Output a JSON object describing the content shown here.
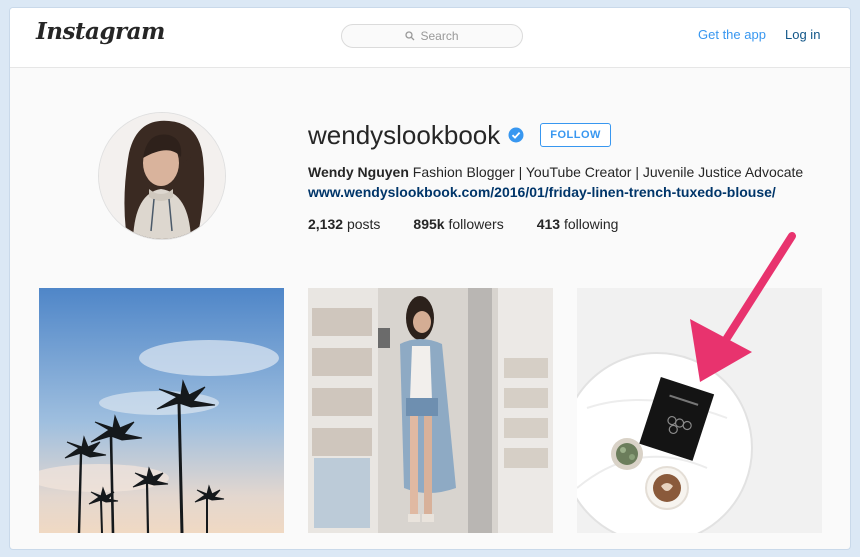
{
  "header": {
    "logo": "Instagram",
    "search_placeholder": "Search",
    "get_app": "Get the app",
    "login": "Log in"
  },
  "profile": {
    "username": "wendyslookbook",
    "verified": true,
    "follow_label": "FOLLOW",
    "full_name": "Wendy Nguyen",
    "bio": "Fashion Blogger | YouTube Creator | Juvenile Justice Advocate",
    "url": "www.wendyslookbook.com/2016/01/friday-linen-trench-tuxedo-blouse/",
    "posts_count": "2,132",
    "posts_label": "posts",
    "followers_count": "895k",
    "followers_label": "followers",
    "following_count": "413",
    "following_label": "following"
  },
  "posts": [
    {
      "subject": "palm trees against blue sky"
    },
    {
      "subject": "woman in denim trench coat in store"
    },
    {
      "subject": "white table with book, coffee and succulent"
    }
  ],
  "colors": {
    "accent": "#3897f0",
    "link": "#003569",
    "annotation_arrow": "#e8336e"
  }
}
